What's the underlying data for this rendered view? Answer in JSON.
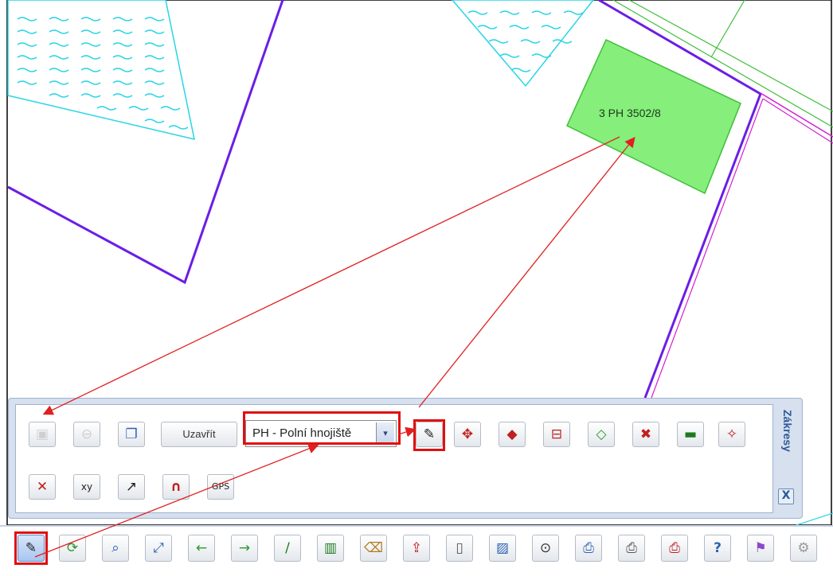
{
  "map": {
    "parcel_label": "3 PH 3502/8",
    "colors": {
      "boundary": "#6a1ee6",
      "water": "#27d6e6",
      "parcel_fill": "#86ee7a",
      "parcel_stroke": "#3fbf3a",
      "annotation": "#e02020"
    }
  },
  "panel": {
    "title": "Zákresy",
    "close_label": "X",
    "toolbar": {
      "save": {
        "icon": "save-icon"
      },
      "cancel": {
        "icon": "no-entry-icon"
      },
      "windows": {
        "icon": "windows-icon"
      },
      "close_text": "Uzavřít",
      "layer_select": {
        "value": "PH - Polní hnojiště",
        "arrow": "▾"
      },
      "draw_icons": [
        {
          "name": "draw-polygon-icon",
          "glyph": "✎"
        },
        {
          "name": "edit-vertices-icon",
          "glyph": "✥"
        },
        {
          "name": "polygon-hatch-icon",
          "glyph": "◆"
        },
        {
          "name": "split-icon",
          "glyph": "⊟"
        },
        {
          "name": "polygon-outline-icon",
          "glyph": "◇"
        },
        {
          "name": "delete-polygon-icon",
          "glyph": "✖"
        },
        {
          "name": "fill-green-icon",
          "glyph": "▬"
        },
        {
          "name": "move-vertex-icon",
          "glyph": "✧"
        }
      ],
      "row2_icons": [
        {
          "name": "delete-vertex-icon",
          "glyph": "✕"
        },
        {
          "name": "xy-coordinates-icon",
          "glyph": "xy"
        },
        {
          "name": "arrow-line-icon",
          "glyph": "↗"
        },
        {
          "name": "magnet-snap-icon",
          "glyph": "∩"
        },
        {
          "name": "gps-icon",
          "glyph": "GPS"
        }
      ]
    }
  },
  "bottom_toolbar": [
    {
      "name": "drawing-tool-icon",
      "glyph": "✎",
      "active": true
    },
    {
      "name": "refresh-icon",
      "glyph": "⟳"
    },
    {
      "name": "zoom-window-icon",
      "glyph": "⌕"
    },
    {
      "name": "zoom-extent-icon",
      "glyph": "⤢"
    },
    {
      "name": "back-icon",
      "glyph": "←"
    },
    {
      "name": "forward-icon",
      "glyph": "→"
    },
    {
      "name": "measure-line-icon",
      "glyph": "/"
    },
    {
      "name": "measure-area-icon",
      "glyph": "▥"
    },
    {
      "name": "clear-icon",
      "glyph": "⌫"
    },
    {
      "name": "export-icon",
      "glyph": "⇪"
    },
    {
      "name": "mobile-icon",
      "glyph": "▯"
    },
    {
      "name": "image-icon",
      "glyph": "▨"
    },
    {
      "name": "search-binoculars-icon",
      "glyph": "⊙"
    },
    {
      "name": "print-icon",
      "glyph": "⎙"
    },
    {
      "name": "print-preview-icon",
      "glyph": "⎙"
    },
    {
      "name": "print-pdf-icon",
      "glyph": "⎙"
    },
    {
      "name": "help-icon",
      "glyph": "?"
    },
    {
      "name": "flag-icon",
      "glyph": "⚑"
    },
    {
      "name": "settings-gear-icon",
      "glyph": "⚙"
    }
  ]
}
